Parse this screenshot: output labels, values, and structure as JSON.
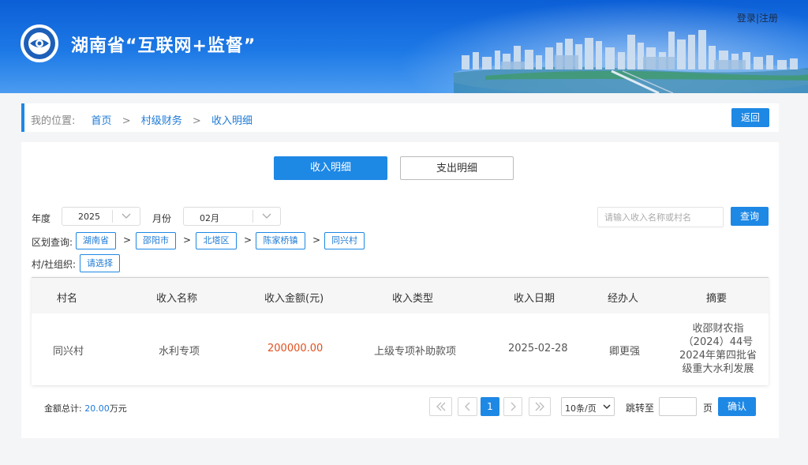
{
  "header": {
    "site_title": "湖南省“互联网+监督”",
    "login": "登录",
    "divider": "|",
    "register": "注册",
    "logo_icon": "eye-emblem-icon",
    "brand_color": "#0c5fd6"
  },
  "breadcrumb": {
    "lead": "我的位置:",
    "items": [
      "首页",
      "村级财务",
      "收入明细"
    ],
    "separator": ">",
    "back_label": "返回"
  },
  "tabs": {
    "income": "收入明细",
    "expense": "支出明细"
  },
  "filters": {
    "year_label": "年度",
    "year_value": "2025",
    "month_label": "月份",
    "month_value": "02月",
    "search_placeholder": "请输入收入名称或村名",
    "query_label": "查询",
    "region_label": "区划查询:",
    "region_chips": [
      "湖南省",
      "邵阳市",
      "北塔区",
      "陈家桥镇",
      "同兴村"
    ],
    "org_label": "村/社组织:",
    "org_select": "请选择"
  },
  "table": {
    "columns": [
      "村名",
      "收入名称",
      "收入金额(元)",
      "收入类型",
      "收入日期",
      "经办人",
      "摘要"
    ],
    "rows": [
      {
        "village": "同兴村",
        "name": "水利专项",
        "amount": "200000.00",
        "type": "上级专项补助款项",
        "date": "2025-02-28",
        "handler": "卿更强",
        "summary": "收邵财农指（2024）44号2024年第四批省级重大水利发展"
      }
    ]
  },
  "footer": {
    "total_label": "金额总计:",
    "total_value": "20.00",
    "total_unit": "万元",
    "current_page": "1",
    "page_size": "10条/页",
    "jump_label": "跳转至",
    "page_unit": "页",
    "confirm_label": "确认"
  },
  "colors": {
    "accent": "#1e88e5",
    "amount": "#e0501f"
  }
}
